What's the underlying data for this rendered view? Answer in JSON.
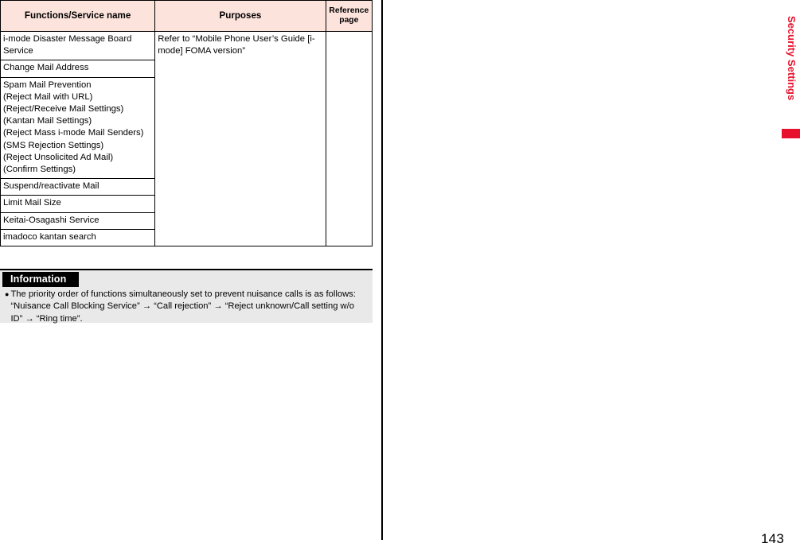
{
  "table": {
    "headers": {
      "functions": "Functions/Service name",
      "purposes": "Purposes",
      "reference": "Reference page"
    },
    "header_bg": "#fce3dc",
    "rows": [
      {
        "function_lines": [
          "i-mode Disaster Message Board",
          "Service"
        ]
      },
      {
        "function_lines": [
          "Change Mail Address"
        ]
      },
      {
        "function_lines": [
          "Spam Mail Prevention",
          "(Reject Mail with URL)",
          "(Reject/Receive Mail Settings)",
          "(Kantan Mail Settings)",
          "(Reject Mass i-mode Mail Senders)",
          "(SMS Rejection Settings)",
          "(Reject Unsolicited Ad Mail)",
          "(Confirm Settings)"
        ]
      },
      {
        "function_lines": [
          "Suspend/reactivate Mail"
        ]
      },
      {
        "function_lines": [
          "Limit Mail Size"
        ]
      },
      {
        "function_lines": [
          "Keitai-Osagashi Service"
        ]
      },
      {
        "function_lines": [
          "imadoco kantan search"
        ]
      }
    ],
    "purposes_merged": "Refer to “Mobile Phone User’s Guide [i-mode] FOMA version”",
    "reference_merged": ""
  },
  "information": {
    "title": "Information",
    "bullet": "●",
    "text": "The priority order of functions simultaneously set to prevent nuisance calls is as follows: “Nuisance Call Blocking Service” → “Call rejection” → “Reject unknown/Call setting w/o ID” → “Ring time”."
  },
  "section_tab": {
    "label": "Security Settings",
    "color": "#e8112d"
  },
  "page_number": "143"
}
